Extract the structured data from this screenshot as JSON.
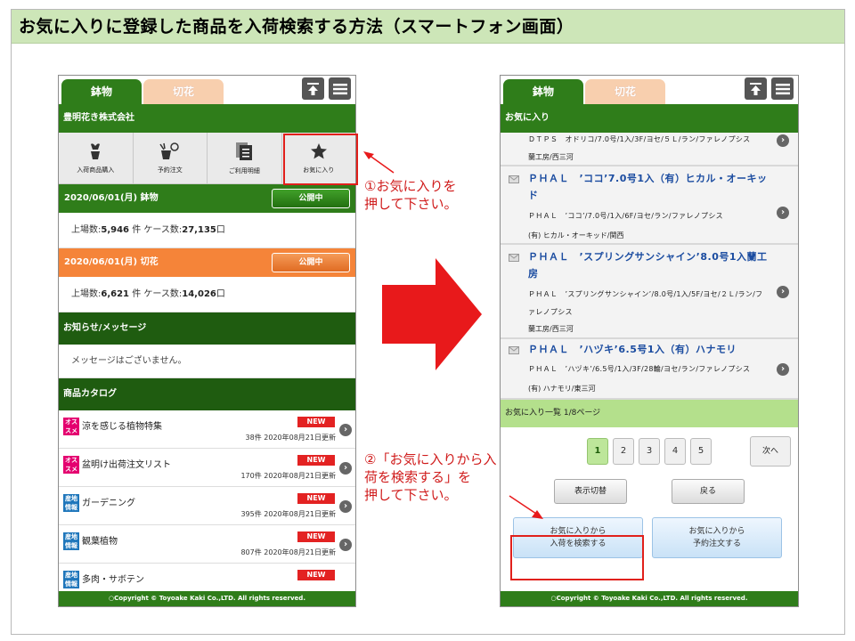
{
  "slide": {
    "title": "お気に入りに登録した商品を入荷検索する方法（スマートフォン画面）",
    "annotation_1": [
      "①お気に入りを",
      "押して下さい。"
    ],
    "annotation_2": [
      "②「お気に入りから入",
      "荷を検索する」を",
      "押して下さい。"
    ],
    "colors": {
      "annotation": "#d01c1c",
      "arrow": "#e8191b",
      "brand_green": "#2f7d1a"
    }
  },
  "tabs": {
    "active": "鉢物",
    "inactive": "切花"
  },
  "toolbar": {
    "icons": [
      "upload-icon",
      "hamburger-icon"
    ]
  },
  "left": {
    "company": "豊明花き株式会社",
    "menu": [
      {
        "label": "入荷商品購入",
        "icon": "flower-pot-icon"
      },
      {
        "label": "予約注文",
        "icon": "watering-icon"
      },
      {
        "label": "ご利用明細",
        "icon": "document-icon"
      },
      {
        "label": "お気に入り",
        "icon": "star-icon"
      }
    ],
    "market_1": {
      "label": "2020/06/01(月) 鉢物",
      "status": "公開中",
      "stats": {
        "count_label": "上場数:",
        "count": "5,946",
        "count_unit": "件",
        "case_label": "ケース数:",
        "case": "27,135",
        "case_unit": "口"
      }
    },
    "market_2": {
      "label": "2020/06/01(月) 切花",
      "status": "公開中",
      "stats": {
        "count_label": "上場数:",
        "count": "6,621",
        "count_unit": "件",
        "case_label": "ケース数:",
        "case": "14,026",
        "case_unit": "口"
      }
    },
    "notice_head": "お知らせ/メッセージ",
    "notice_msg": "メッセージはございません。",
    "catalog_head": "商品カタログ",
    "catalog": [
      {
        "badge": [
          "オス",
          "スメ"
        ],
        "name": "涼を感じる植物特集",
        "new": "NEW",
        "meta": "38件 2020年08月21日更新"
      },
      {
        "badge": [
          "オス",
          "スメ"
        ],
        "name": "盆明け出荷注文リスト",
        "new": "NEW",
        "meta": "170件 2020年08月21日更新"
      },
      {
        "badge": [
          "産地",
          "情報"
        ],
        "name": "ガーデニング",
        "new": "NEW",
        "meta": "395件 2020年08月21日更新"
      },
      {
        "badge": [
          "産地",
          "情報"
        ],
        "name": "観葉植物",
        "new": "NEW",
        "meta": "807件 2020年08月21日更新"
      },
      {
        "badge": [
          "産地",
          "情報"
        ],
        "name": "多肉・サボテン",
        "new": "NEW",
        "meta": ""
      }
    ],
    "footer": "○Copyright © Toyoake Kaki Co.,LTD. All rights reserved."
  },
  "right": {
    "head": "お気に入り",
    "items": [
      {
        "title": "",
        "desc": [
          "ＤＴＰＳ　オドリコ/7.0号/1入/3F/ヨセ/５Ｌ/ラン/ファレノプシス"
        ],
        "org": "蘭工房/西三河"
      },
      {
        "title": [
          "ＰＨＡＬ　’ココ’7.0号1入（有）ヒカル・オーキッ",
          "ド"
        ],
        "desc": [
          "ＰＨＡＬ　’ココ’/7.0号/1入/6F/ヨセ/ラン/ファレノプシス"
        ],
        "org": "(有) ヒカル・オーキッド/関西"
      },
      {
        "title": [
          "ＰＨＡＬ　’スプリングサンシャイン’8.0号1入蘭工",
          "房"
        ],
        "desc": [
          "ＰＨＡＬ　’スプリングサンシャイン’/8.0号/1入/5F/ヨセ/２Ｌ/ラン/フ",
          "ァレノプシス"
        ],
        "org": "蘭工房/西三河"
      },
      {
        "title": [
          "ＰＨＡＬ　’ハヅキ’6.5号1入（有）ハナモリ"
        ],
        "desc": [
          "ＰＨＡＬ　’ハヅキ’/6.5号/1入/3F/28輪/ヨセ/ラン/ファレノプシス"
        ],
        "org": "(有) ハナモリ/東三河"
      }
    ],
    "list_info": "お気に入り一覧 1/8ページ",
    "pages": [
      "1",
      "2",
      "3",
      "4",
      "5"
    ],
    "current_page": "1",
    "next": "次へ",
    "toggle": "表示切替",
    "back": "戻る",
    "search_btn": [
      "お気に入りから",
      "入荷を検索する"
    ],
    "order_btn": [
      "お気に入りから",
      "予約注文する"
    ],
    "footer": "○Copyright © Toyoake Kaki Co.,LTD. All rights reserved."
  }
}
